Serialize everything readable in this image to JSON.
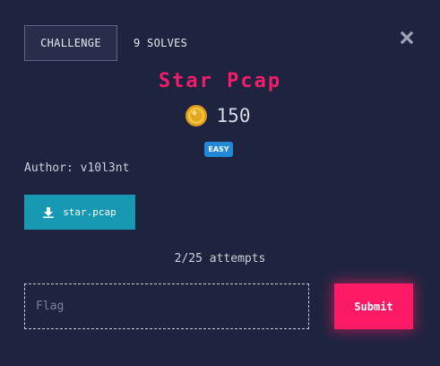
{
  "tabs": {
    "challenge_label": "CHALLENGE",
    "solves_label": "9 SOLVES"
  },
  "icons": {
    "close": "close-icon",
    "coin": "coin-icon",
    "download": "download-icon"
  },
  "challenge": {
    "title": "Star Pcap",
    "points": "150",
    "difficulty": "EASY",
    "author": "Author: v10l3nt",
    "file_label": "star.pcap",
    "attempts": "2/25 attempts"
  },
  "form": {
    "flag_placeholder": "Flag",
    "flag_value": "",
    "submit_label": "Submit"
  },
  "colors": {
    "background": "#1e2440",
    "title": "#f21d68",
    "difficulty_badge": "#2389d6",
    "download_button": "#1798b3",
    "submit_button": "#ff1a66"
  }
}
